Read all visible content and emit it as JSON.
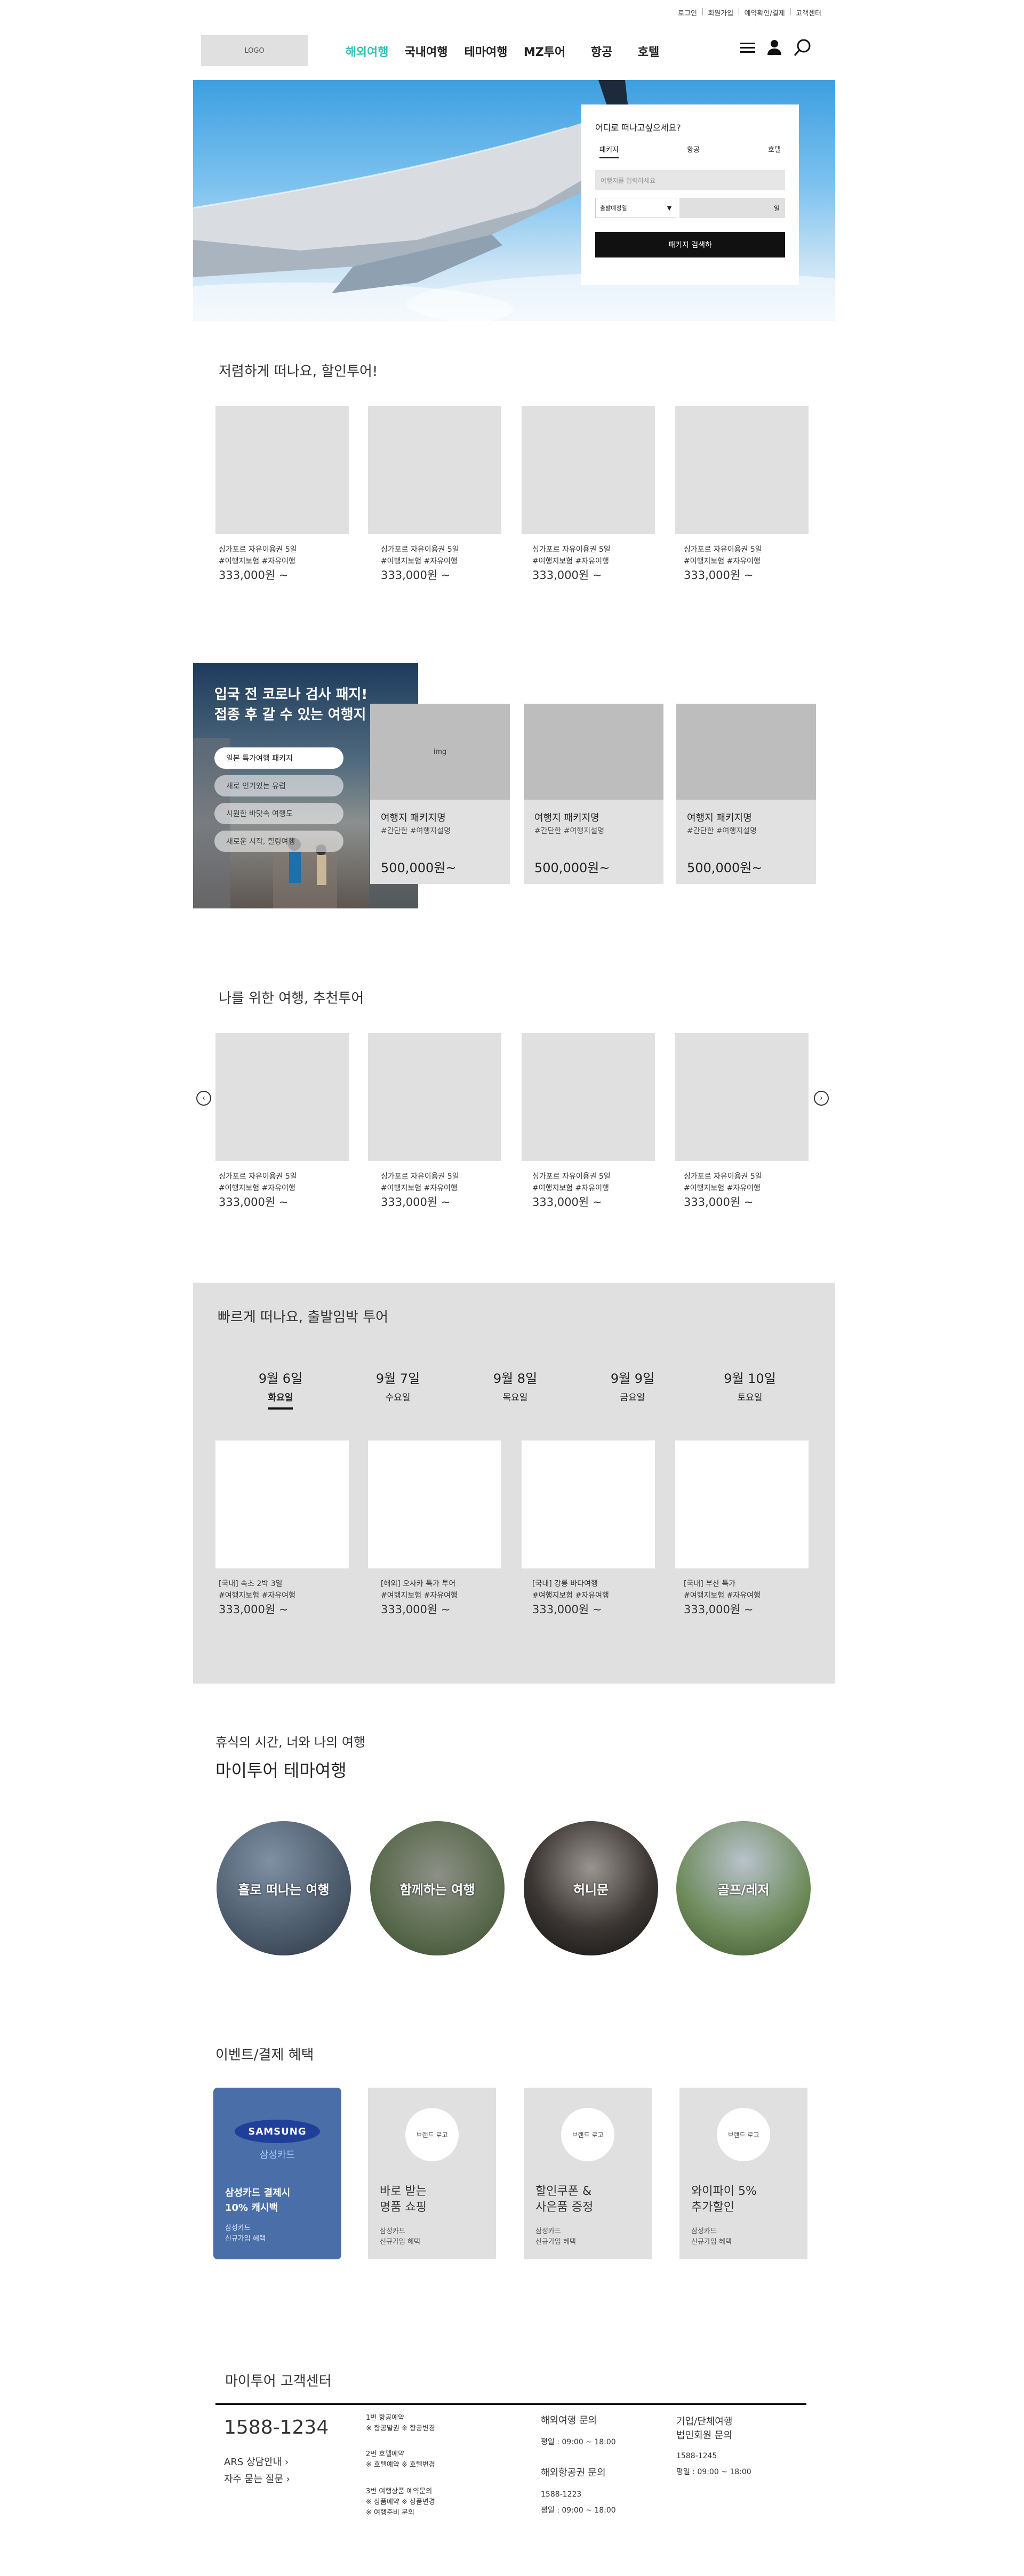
{
  "header": {
    "top_links": [
      "로그인",
      "회원가입",
      "예약확인/결제",
      "고객센터"
    ],
    "logo": "LOGO",
    "nav": [
      "해외여행",
      "국내여행",
      "테마여행",
      "MZ투어",
      "항공",
      "호텔"
    ],
    "active_color": "#35bfb8",
    "icons": [
      "menu-icon",
      "user-icon",
      "search-icon"
    ]
  },
  "hero": {
    "search": {
      "title": "어디로 떠나고싶으세요?",
      "tabs": [
        "패키지",
        "항공",
        "호텔"
      ],
      "destination_placeholder": "여행지를 입력하세요",
      "date_select": "출발예정일",
      "day_label": "일",
      "button": "패키지 검색하",
      "button_color": "#111111"
    }
  },
  "discount": {
    "title": "저렴하게 떠나요, 할인투어!",
    "items": [
      {
        "name": "싱가포르 자유이용권 5일",
        "tags": "#여행지보험 #자유여행",
        "price": "333,000원 ~"
      },
      {
        "name": "싱가포르 자유이용권 5일",
        "tags": "#여행지보험 #자유여행",
        "price": "333,000원 ~"
      },
      {
        "name": "싱가포르 자유이용권 5일",
        "tags": "#여행지보험 #자유여행",
        "price": "333,000원 ~"
      },
      {
        "name": "싱가포르 자유이용권 5일",
        "tags": "#여행지보험 #자유여행",
        "price": "333,000원 ~"
      }
    ]
  },
  "promo": {
    "title_line1": "입국 전 코로나 검사 패지!",
    "title_line2": "접종 후 갈 수 있는 여행지",
    "buttons": [
      "일본 특가여행 패키지",
      "새로 인기있는 유럽",
      "시원한 바닷속 여행도",
      "새로운 시작, 힐링여행"
    ],
    "cards": [
      {
        "img": "img",
        "name": "여행지 패키지명",
        "desc": "#간단한 #여행지설명",
        "price": "500,000원~"
      },
      {
        "img": "",
        "name": "여행지 패키지명",
        "desc": "#간단한 #여행지설명",
        "price": "500,000원~"
      },
      {
        "img": "",
        "name": "여행지 패키지명",
        "desc": "#간단한 #여행지설명",
        "price": "500,000원~"
      }
    ]
  },
  "recommend": {
    "title": "나를 위한 여행, 추천투어",
    "items": [
      {
        "name": "싱가포르 자유이용권 5일",
        "tags": "#여행지보험 #자유여행",
        "price": "333,000원 ~"
      },
      {
        "name": "싱가포르 자유이용권 5일",
        "tags": "#여행지보험 #자유여행",
        "price": "333,000원 ~"
      },
      {
        "name": "싱가포르 자유이용권 5일",
        "tags": "#여행지보험 #자유여행",
        "price": "333,000원 ~"
      },
      {
        "name": "싱가포르 자유이용권 5일",
        "tags": "#여행지보험 #자유여행",
        "price": "333,000원 ~"
      }
    ]
  },
  "departure": {
    "title": "빠르게 떠나요, 출발임박 투어",
    "days": [
      {
        "date": "9월 6일",
        "weekday": "화요일"
      },
      {
        "date": "9월 7일",
        "weekday": "수요일"
      },
      {
        "date": "9월 8일",
        "weekday": "목요일"
      },
      {
        "date": "9월 9일",
        "weekday": "금요일"
      },
      {
        "date": "9월 10일",
        "weekday": "토요일"
      }
    ],
    "items": [
      {
        "name": "[국내] 속초 2박 3일",
        "tags": "#여행지보험 #자유여행",
        "price": "333,000원 ~"
      },
      {
        "name": "[해외] 오사카 특가 투어",
        "tags": "#여행지보험 #자유여행",
        "price": "333,000원 ~"
      },
      {
        "name": "[국내] 강릉 바다여행",
        "tags": "#여행지보험 #자유여행",
        "price": "333,000원 ~"
      },
      {
        "name": "[국내] 부산 특가",
        "tags": "#여행지보험 #자유여행",
        "price": "333,000원 ~"
      }
    ]
  },
  "theme": {
    "subtitle": "휴식의 시간, 너와 나의 여행",
    "title": "마이투어 테마여행",
    "items": [
      "홀로 떠나는 여행",
      "함께하는 여행",
      "허니문",
      "골프/레저"
    ]
  },
  "events": {
    "title": "이벤트/결제 혜택",
    "samsung": {
      "brand": "SAMSUNG",
      "card": "삼성카드",
      "title1": "삼성카드 결제시",
      "title2": "10% 캐시백",
      "sub1": "삼성카드",
      "sub2": "신규가입 혜택",
      "color": "#4a6fa8"
    },
    "items": [
      {
        "logo": "브랜드 로고",
        "t1": "바로 받는",
        "t2": "명품 쇼핑",
        "s1": "삼성카드",
        "s2": "신규가입 혜택"
      },
      {
        "logo": "브랜드 로고",
        "t1": "할인쿠폰 &",
        "t2": "사은품 증정",
        "s1": "삼성카드",
        "s2": "신규가입 혜택"
      },
      {
        "logo": "브랜드 로고",
        "t1": "와이파이 5%",
        "t2": "추가할인",
        "s1": "삼성카드",
        "s2": "신규가입 혜택"
      }
    ]
  },
  "footer": {
    "title": "마이투어 고객센터",
    "phone": "1588-1234",
    "ars": "ARS 상담안내",
    "faq": "자주 묻는 질문",
    "menu": [
      {
        "no": "1번 항공예약",
        "sub": "※ 항공발권 ※ 항공변경"
      },
      {
        "no": "2번 호텔예약",
        "sub": "※ 호텔예약 ※ 호텔변경"
      },
      {
        "no": "3번 여행상품 예약문의",
        "sub": "※ 상품예약 ※ 상품변경",
        "sub2": "※ 여행준비 문의"
      }
    ],
    "overseas": {
      "title": "해외여행 문의",
      "hours": "평일 : 09:00 ~ 18:00"
    },
    "air": {
      "title": "해외항공권 문의",
      "phone": "1588-1223",
      "hours": "평일 : 09:00 ~ 18:00"
    },
    "corp": {
      "title1": "기업/단체여행",
      "title2": "법인회원 문의",
      "phone": "1588-1245",
      "hours": "평일 : 09:00 ~ 18:00"
    }
  }
}
